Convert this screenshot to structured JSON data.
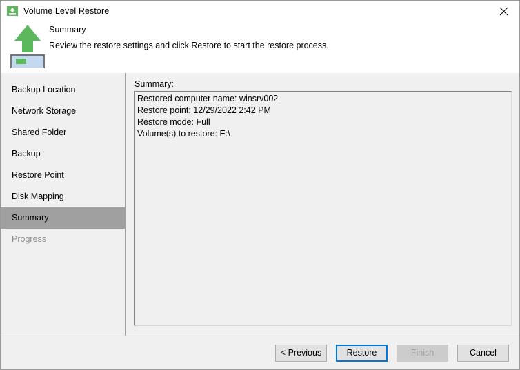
{
  "window": {
    "title": "Volume Level Restore",
    "title_icon": "volume-restore-icon",
    "close_label": "✕"
  },
  "header": {
    "icon": "green-up-arrow-volume-icon",
    "title": "Summary",
    "subtitle": "Review the restore settings and click Restore to start the restore process."
  },
  "sidebar": {
    "items": [
      {
        "label": "Backup Location",
        "state": "normal"
      },
      {
        "label": "Network Storage",
        "state": "normal"
      },
      {
        "label": "Shared Folder",
        "state": "normal"
      },
      {
        "label": "Backup",
        "state": "normal"
      },
      {
        "label": "Restore Point",
        "state": "normal"
      },
      {
        "label": "Disk Mapping",
        "state": "normal"
      },
      {
        "label": "Summary",
        "state": "active"
      },
      {
        "label": "Progress",
        "state": "disabled"
      }
    ]
  },
  "content": {
    "summary_label": "Summary:",
    "summary_lines": [
      "Restored computer name: winsrv002",
      "Restore point: 12/29/2022 2:42 PM",
      "Restore mode: Full",
      "Volume(s) to restore: E:\\"
    ]
  },
  "footer": {
    "buttons": [
      {
        "label": "< Previous",
        "state": "normal"
      },
      {
        "label": "Restore",
        "state": "focused"
      },
      {
        "label": "Finish",
        "state": "disabled"
      },
      {
        "label": "Cancel",
        "state": "normal"
      }
    ]
  },
  "colors": {
    "accent_green": "#5cb85c",
    "focus_blue": "#0078d7",
    "selection_gray": "#a0a0a0",
    "disk_blue": "#c3d9ef",
    "body_gray": "#f0f0f0"
  }
}
